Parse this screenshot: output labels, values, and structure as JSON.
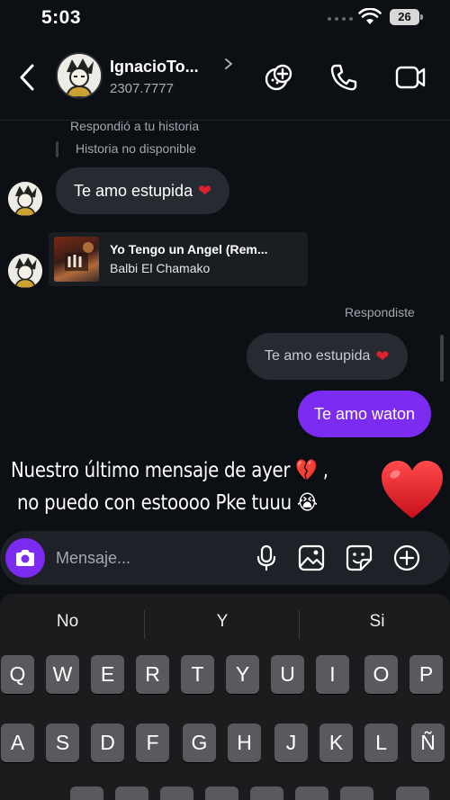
{
  "status_bar": {
    "time": "5:03",
    "battery": "26"
  },
  "header": {
    "name": "IgnacioTo...",
    "subtitle": "2307.7777"
  },
  "thread": {
    "reply_note": "Respondió a tu historia",
    "story_unavailable": "Historia no disponible",
    "incoming_message": "Te amo estupida",
    "music": {
      "title": "Yo Tengo un Angel (Rem...",
      "artist": "Balbi El Chamako"
    },
    "reply_label": "Respondiste",
    "outgoing_reply": "Te amo estupida",
    "outgoing_message": "Te amo waton"
  },
  "overlay": {
    "line1": "Nuestro último mensaje de ayer 💔 ,",
    "line2": "no puedo con estoooo Pke tuuu 😭"
  },
  "composer": {
    "placeholder": "Mensaje..."
  },
  "keyboard": {
    "suggestions": [
      "No",
      "Y",
      "Si"
    ],
    "row1": [
      "Q",
      "W",
      "E",
      "R",
      "T",
      "Y",
      "U",
      "I",
      "O",
      "P"
    ],
    "row2": [
      "A",
      "S",
      "D",
      "F",
      "G",
      "H",
      "J",
      "K",
      "L",
      "Ñ"
    ]
  },
  "colors": {
    "accent": "#7c2bf0",
    "background": "#0c0f14",
    "bubble": "#262a31",
    "heart": "#e0202e"
  }
}
